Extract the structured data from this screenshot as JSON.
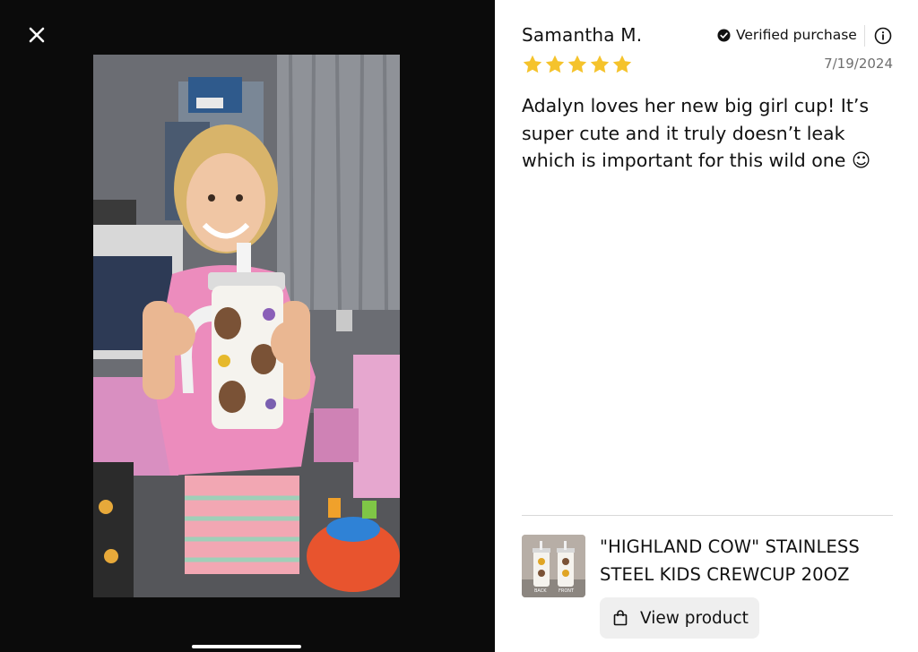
{
  "viewer": {
    "close_icon": "close-icon",
    "photo_icon": "review-photo"
  },
  "review": {
    "reviewer_name": "Samantha M.",
    "verified_label": "Verified purchase",
    "verified_icon": "check-circle-icon",
    "info_icon": "info-icon",
    "rating": 5,
    "rating_max": 5,
    "star_color": "#f5c32c",
    "date": "7/19/2024",
    "body": "Adalyn loves her new big girl cup! It’s super cute and it truly doesn’t leak which is important for this wild one ☺"
  },
  "product": {
    "title": "\"HIGHLAND COW\" STAINLESS STEEL KIDS CREWCUP 20OZ",
    "thumb_labels": [
      "BACK",
      "FRONT"
    ],
    "view_button_label": "View product",
    "view_button_icon": "shopping-bag-icon"
  }
}
